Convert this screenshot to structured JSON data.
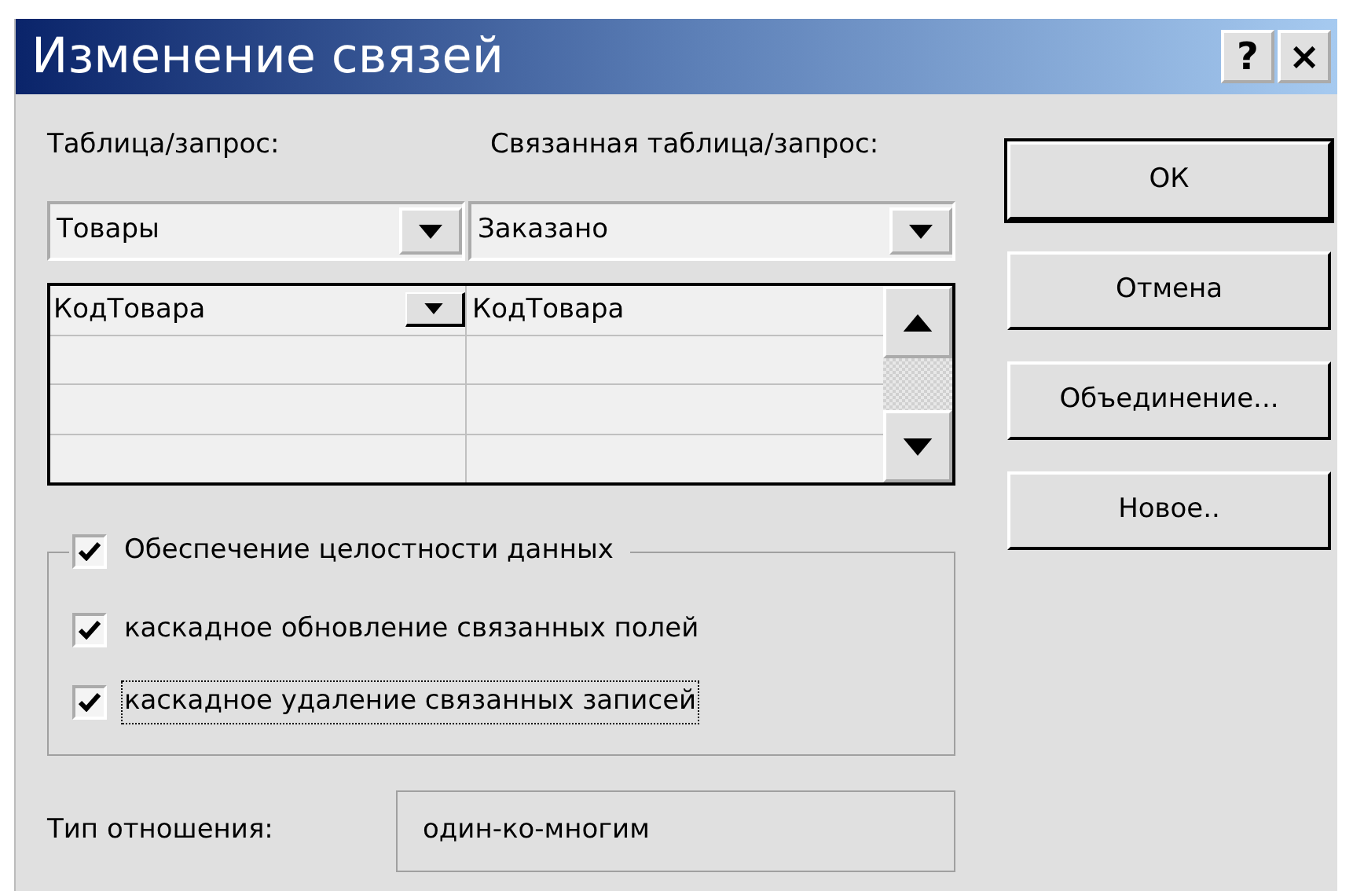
{
  "window": {
    "title": "Изменение связей",
    "title_buttons": [
      "?",
      "×"
    ]
  },
  "table_label": "Таблица/запрос:",
  "related_label": "Связанная таблица/запрос:",
  "table_combo": {
    "value": "Товары"
  },
  "related_combo": {
    "value": "Заказано"
  },
  "grid": {
    "rows": [
      {
        "cells": [
          "КодТовара",
          "КодТовара"
        ],
        "selected": true
      }
    ]
  },
  "options": [
    {
      "label": "Обеспечение целостности данных",
      "checked": true,
      "focused": false,
      "kind": "legend"
    },
    {
      "label": "каскадное обновление связанных полей",
      "checked": true,
      "focused": false,
      "kind": "item"
    },
    {
      "label": "каскадное удаление связанных записей",
      "checked": true,
      "focused": true,
      "kind": "item"
    }
  ],
  "relation": {
    "label": "Тип отношения:",
    "value": "один-ко-многим"
  },
  "buttons": [
    {
      "label": "ОК",
      "default": true
    },
    {
      "label": "Отмена",
      "default": false
    },
    {
      "label": "Объединение...",
      "default": false
    },
    {
      "label": "Новое..",
      "default": false
    }
  ]
}
